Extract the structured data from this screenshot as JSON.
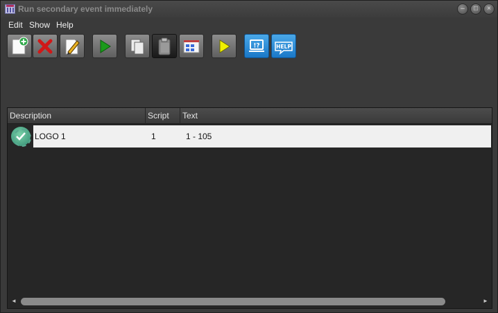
{
  "window": {
    "title": "Run secondary event immediately"
  },
  "titlebar_buttons": {
    "minimize": "–",
    "maximize": "□",
    "close": "×"
  },
  "menu": {
    "items": [
      "Edit",
      "Show",
      "Help"
    ]
  },
  "toolbar": {
    "buttons": [
      {
        "name": "new-event",
        "icon": "new-document-plus-icon"
      },
      {
        "name": "delete",
        "icon": "red-x-icon"
      },
      {
        "name": "edit",
        "icon": "pencil-edit-icon"
      },
      {
        "name": "run",
        "icon": "green-play-icon"
      },
      {
        "name": "copy",
        "icon": "copy-pages-icon"
      },
      {
        "name": "paste",
        "icon": "clipboard-paste-icon"
      },
      {
        "name": "layout",
        "icon": "window-grid-icon"
      },
      {
        "name": "run-secondary",
        "icon": "yellow-play-icon"
      },
      {
        "name": "about",
        "icon": "monitor-question-icon"
      },
      {
        "name": "help",
        "icon": "help-badge-icon",
        "label": "HELP"
      }
    ]
  },
  "list": {
    "columns": [
      "Description",
      "Script",
      "Text"
    ],
    "rows": [
      {
        "status_icon": "green-check-badge-icon",
        "description": "LOGO 1",
        "script": "1",
        "text": "1 - 105"
      }
    ]
  },
  "scrollbar": {
    "left_arrow": "◄",
    "right_arrow": "►"
  },
  "colors": {
    "background": "#3a3a3a",
    "list_bg": "#262626",
    "selected_row": "#f0f0f0",
    "help_blue": "#1a78c8"
  }
}
